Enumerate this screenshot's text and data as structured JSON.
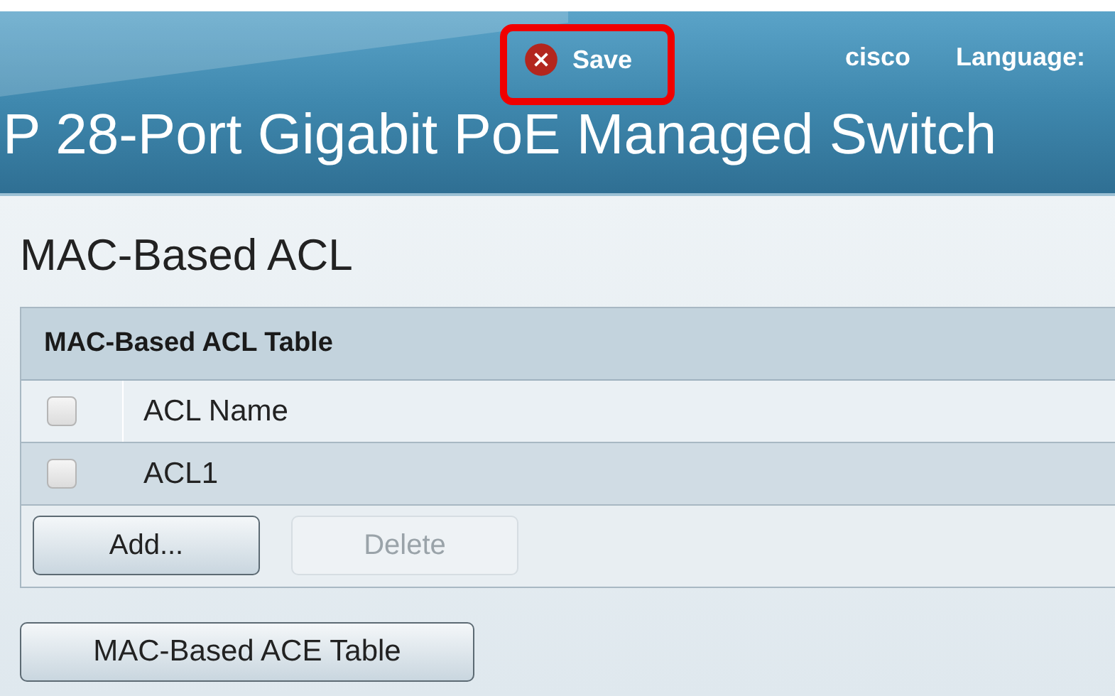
{
  "header": {
    "save": {
      "label": "Save",
      "highlighted": true
    },
    "user": "cisco",
    "language_label": "Language:",
    "product_title": "P 28-Port Gigabit PoE Managed Switch"
  },
  "page_title": "MAC-Based ACL",
  "table": {
    "title": "MAC-Based ACL Table",
    "header": {
      "label": "ACL Name",
      "checked": false
    },
    "rows": [
      {
        "name": "ACL1",
        "checked": false
      }
    ],
    "buttons": [
      {
        "label": "Add...",
        "disabled": false
      },
      {
        "label": "Delete",
        "disabled": true
      }
    ]
  },
  "footer_button": "MAC-Based ACE Table"
}
